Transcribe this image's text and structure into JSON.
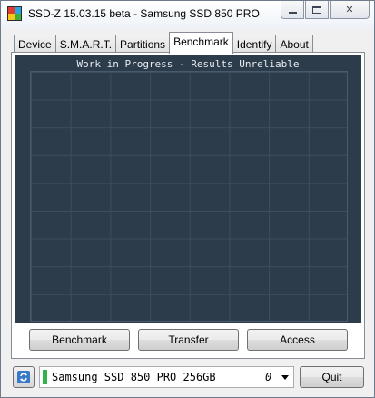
{
  "window": {
    "title": "SSD-Z 15.03.15 beta - Samsung SSD 850 PRO",
    "min_glyph": "",
    "max_glyph": "",
    "close_glyph": "✕"
  },
  "tabs": [
    {
      "label": "Device"
    },
    {
      "label": "S.M.A.R.T."
    },
    {
      "label": "Partitions"
    },
    {
      "label": "Benchmark",
      "active": true
    },
    {
      "label": "Identify"
    },
    {
      "label": "About"
    }
  ],
  "benchmark": {
    "graph_title": "Work in Progress - Results Unreliable",
    "buttons": {
      "benchmark": "Benchmark",
      "transfer": "Transfer",
      "access": "Access"
    }
  },
  "footer": {
    "drive_name": "Samsung SSD 850 PRO 256GB",
    "drive_index": "0",
    "quit_label": "Quit",
    "health_color": "#2fb34a"
  },
  "colors": {
    "graph_background": "#2d3c4b",
    "grid_lines": "#3b4e60"
  },
  "icons": {
    "refresh": "refresh-icon",
    "app": "app-icon"
  }
}
